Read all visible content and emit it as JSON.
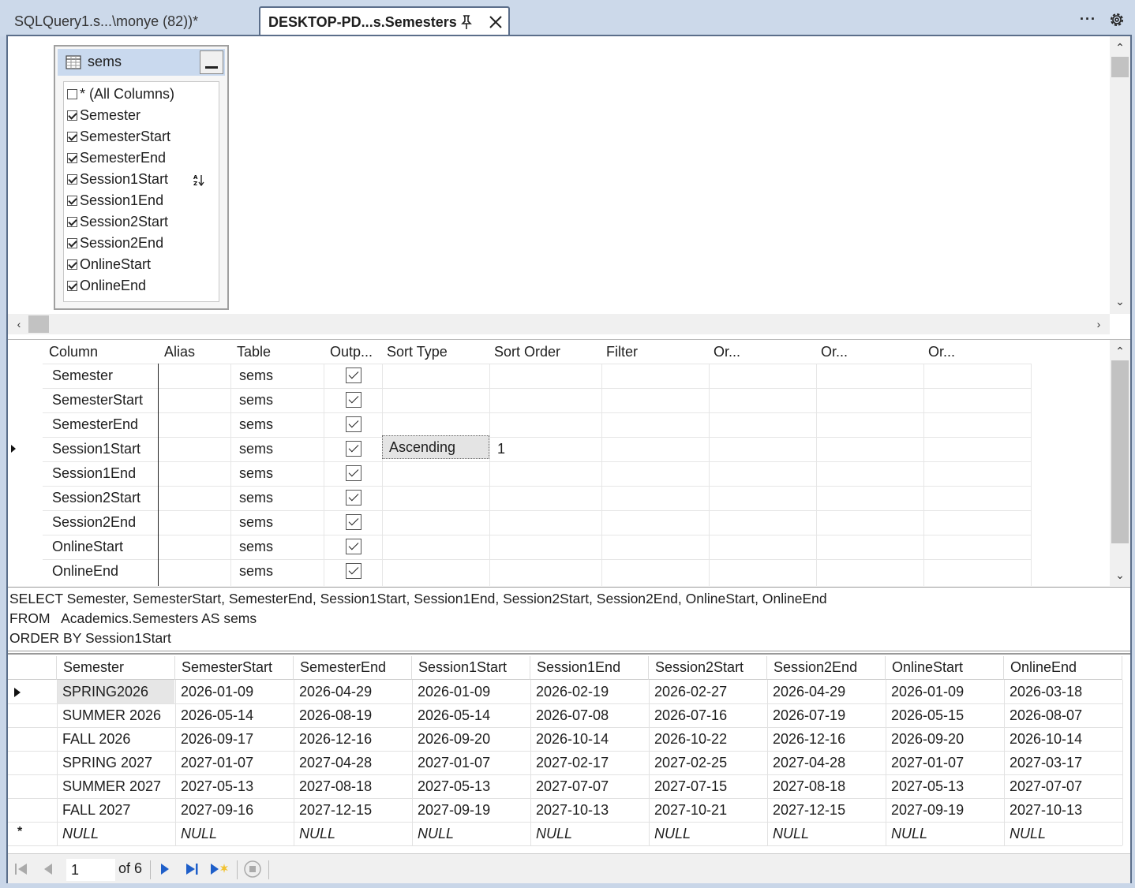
{
  "tabs": [
    {
      "label": "SQLQuery1.s...\\monye (82))*",
      "active": false
    },
    {
      "label": "DESKTOP-PD...s.Semesters",
      "active": true
    }
  ],
  "icons": {
    "pin": "pin-icon",
    "close": "close-icon",
    "more": "more-options-icon",
    "settings": "gear-icon",
    "table": "table-grid-icon",
    "sort": "sort-ascending-icon"
  },
  "diagram": {
    "table_name": "sems",
    "columns": [
      {
        "label": "* (All Columns)",
        "checked": false
      },
      {
        "label": "Semester",
        "checked": true
      },
      {
        "label": "SemesterStart",
        "checked": true
      },
      {
        "label": "SemesterEnd",
        "checked": true
      },
      {
        "label": "Session1Start",
        "checked": true
      },
      {
        "label": "Session1End",
        "checked": true
      },
      {
        "label": "Session2Start",
        "checked": true
      },
      {
        "label": "Session2End",
        "checked": true
      },
      {
        "label": "OnlineStart",
        "checked": true
      },
      {
        "label": "OnlineEnd",
        "checked": true
      }
    ]
  },
  "criteria": {
    "headers": [
      "Column",
      "Alias",
      "Table",
      "Outp...",
      "Sort Type",
      "Sort Order",
      "Filter",
      "Or...",
      "Or...",
      "Or..."
    ],
    "rows": [
      {
        "column": "Semester",
        "alias": "",
        "table": "sems",
        "output": true,
        "sort_type": "",
        "sort_order": ""
      },
      {
        "column": "SemesterStart",
        "alias": "",
        "table": "sems",
        "output": true,
        "sort_type": "",
        "sort_order": ""
      },
      {
        "column": "SemesterEnd",
        "alias": "",
        "table": "sems",
        "output": true,
        "sort_type": "",
        "sort_order": ""
      },
      {
        "column": "Session1Start",
        "alias": "",
        "table": "sems",
        "output": true,
        "sort_type": "Ascending",
        "sort_order": "1"
      },
      {
        "column": "Session1End",
        "alias": "",
        "table": "sems",
        "output": true,
        "sort_type": "",
        "sort_order": ""
      },
      {
        "column": "Session2Start",
        "alias": "",
        "table": "sems",
        "output": true,
        "sort_type": "",
        "sort_order": ""
      },
      {
        "column": "Session2End",
        "alias": "",
        "table": "sems",
        "output": true,
        "sort_type": "",
        "sort_order": ""
      },
      {
        "column": "OnlineStart",
        "alias": "",
        "table": "sems",
        "output": true,
        "sort_type": "",
        "sort_order": ""
      },
      {
        "column": "OnlineEnd",
        "alias": "",
        "table": "sems",
        "output": true,
        "sort_type": "",
        "sort_order": ""
      }
    ]
  },
  "sql": {
    "line1": "SELECT Semester, SemesterStart, SemesterEnd, Session1Start, Session1End, Session2Start, Session2End, OnlineStart, OnlineEnd",
    "line2": "FROM   Academics.Semesters AS sems",
    "line3": "ORDER BY Session1Start"
  },
  "results": {
    "headers": [
      "Semester",
      "SemesterStart",
      "SemesterEnd",
      "Session1Start",
      "Session1End",
      "Session2Start",
      "Session2End",
      "OnlineStart",
      "OnlineEnd"
    ],
    "rows": [
      [
        "SPRING2026",
        "2026-01-09",
        "2026-04-29",
        "2026-01-09",
        "2026-02-19",
        "2026-02-27",
        "2026-04-29",
        "2026-01-09",
        "2026-03-18"
      ],
      [
        "SUMMER 2026",
        "2026-05-14",
        "2026-08-19",
        "2026-05-14",
        "2026-07-08",
        "2026-07-16",
        "2026-07-19",
        "2026-05-15",
        "2026-08-07"
      ],
      [
        "FALL 2026",
        "2026-09-17",
        "2026-12-16",
        "2026-09-20",
        "2026-10-14",
        "2026-10-22",
        "2026-12-16",
        "2026-09-20",
        "2026-10-14"
      ],
      [
        "SPRING 2027",
        "2027-01-07",
        "2027-04-28",
        "2027-01-07",
        "2027-02-17",
        "2027-02-25",
        "2027-04-28",
        "2027-01-07",
        "2027-03-17"
      ],
      [
        "SUMMER 2027",
        "2027-05-13",
        "2027-08-18",
        "2027-05-13",
        "2027-07-07",
        "2027-07-15",
        "2027-08-18",
        "2027-05-13",
        "2027-07-07"
      ],
      [
        "FALL 2027",
        "2027-09-16",
        "2027-12-15",
        "2027-09-19",
        "2027-10-13",
        "2027-10-21",
        "2027-12-15",
        "2027-09-19",
        "2027-10-13"
      ],
      [
        "NULL",
        "NULL",
        "NULL",
        "NULL",
        "NULL",
        "NULL",
        "NULL",
        "NULL",
        "NULL"
      ]
    ]
  },
  "nav": {
    "current_page": "1",
    "of_label": "of 6"
  }
}
